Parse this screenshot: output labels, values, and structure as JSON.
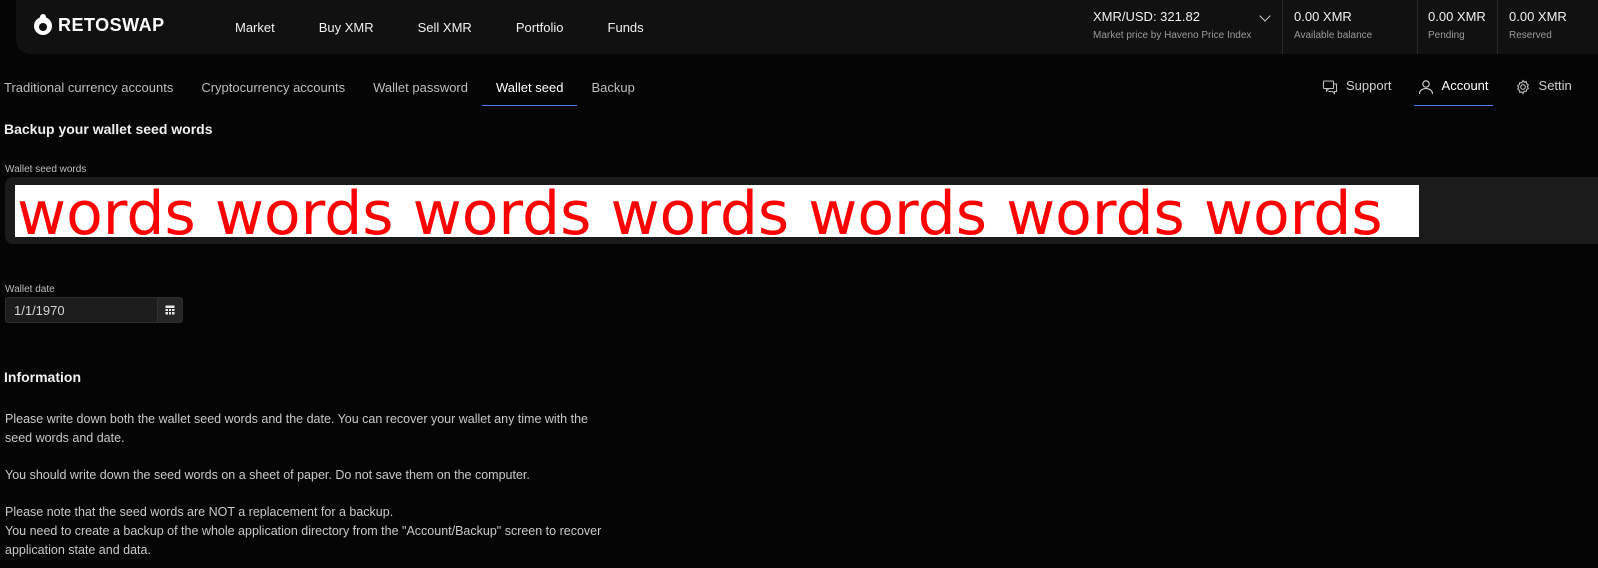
{
  "brand": {
    "name": "RETOSWAP"
  },
  "nav": [
    "Market",
    "Buy XMR",
    "Sell XMR",
    "Portfolio",
    "Funds"
  ],
  "price": {
    "value": "XMR/USD: 321.82",
    "caption": "Market price by Haveno Price Index"
  },
  "balances": [
    {
      "value": "0.00 XMR",
      "label": "Available balance"
    },
    {
      "value": "0.00 XMR",
      "label": "Pending"
    },
    {
      "value": "0.00 XMR",
      "label": "Reserved"
    }
  ],
  "subnav": {
    "tabs": [
      "Traditional currency accounts",
      "Cryptocurrency accounts",
      "Wallet password",
      "Wallet seed",
      "Backup"
    ],
    "active": "Wallet seed"
  },
  "rightnav": {
    "support": "Support",
    "account": "Account",
    "settings": "Settin"
  },
  "page": {
    "title": "Backup your wallet seed words"
  },
  "seed": {
    "label": "Wallet seed words",
    "value": "words words words words words words words"
  },
  "date": {
    "label": "Wallet date",
    "value": "1/1/1970"
  },
  "info": {
    "heading": "Information",
    "p1": "Please write down both the wallet seed words and the date. You can recover your wallet any time with the seed words and date.",
    "p2": "You should write down the seed words on a sheet of paper. Do not save them on the computer.",
    "p3a": "Please note that the seed words are NOT a replacement for a backup.",
    "p3b": "You need to create a backup of the whole application directory from the \"Account/Backup\" screen to recover application state and data."
  },
  "colors": {
    "accent": "#4f79ff",
    "seed_text": "#ff0000",
    "background": "#050505"
  },
  "icons": [
    "chevron-down-icon",
    "support-icon",
    "account-icon",
    "settings-icon",
    "calendar-icon"
  ]
}
